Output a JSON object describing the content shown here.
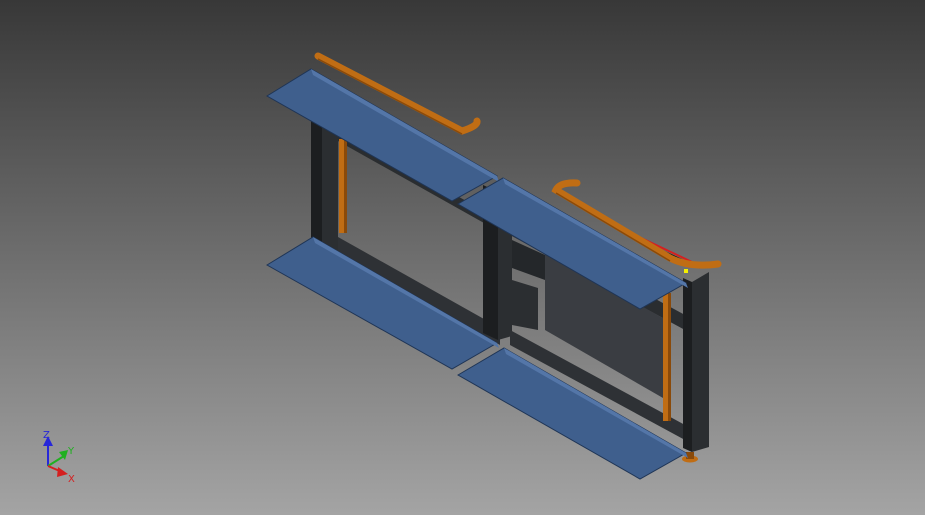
{
  "viewport": {
    "background_top": "#383838",
    "background_bottom": "#a4a4a4"
  },
  "model": {
    "panel_color": "#3f5f8d",
    "panel_edge_color": "#1f3556",
    "frame_color": "#2b2e31",
    "frame_dark": "#1c1e20",
    "rail_color": "#c06d14",
    "rail_dark": "#8a4a0a",
    "selection_color": "#d42020",
    "grip_point_color": "#f5f000"
  },
  "view_cube_triad": {
    "z_label": "Z",
    "y_label": "Y",
    "x_label": "X",
    "z_color": "#2727d9",
    "y_color": "#20b020",
    "x_color": "#d42020"
  }
}
